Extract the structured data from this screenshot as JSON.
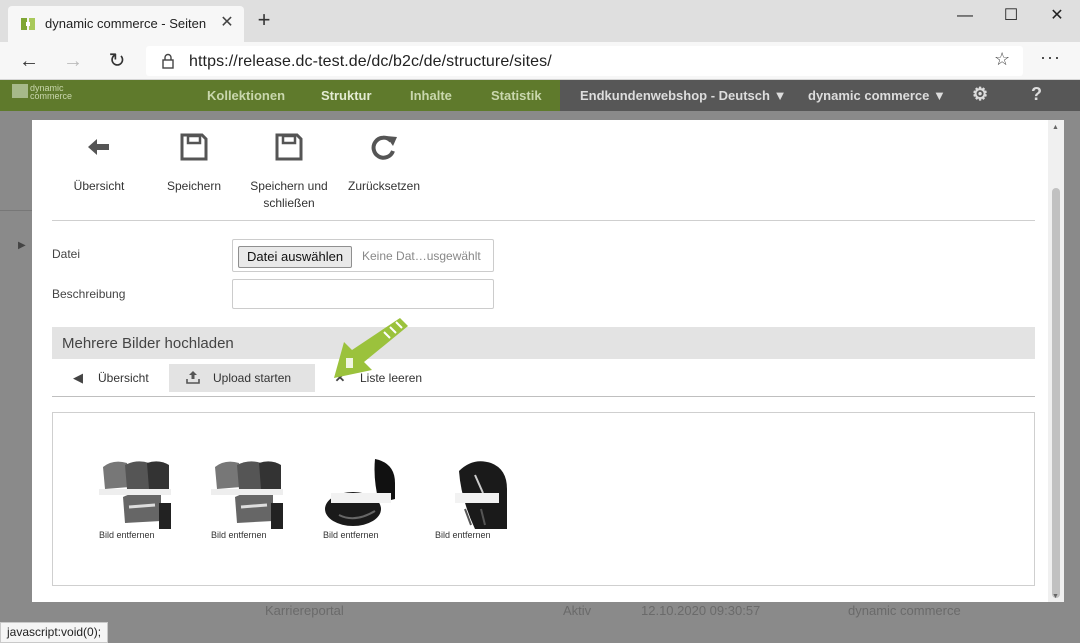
{
  "browser": {
    "tab_title": "dynamic commerce - Seiten",
    "url": "https://release.dc-test.de/dc/b2c/de/structure/sites/",
    "status_url": "javascript:void(0);"
  },
  "app": {
    "logo_line1": "dynamic",
    "logo_line2": "commerce",
    "nav": [
      "Kollektionen",
      "Struktur",
      "Inhalte",
      "Statistik"
    ],
    "shop_select": "Endkundenwebshop - Deutsch",
    "company_select": "dynamic commerce",
    "background_row": {
      "name": "Karriereportal",
      "status": "Aktiv",
      "date": "12.10.2020 09:30:57",
      "owner": "dynamic commerce"
    }
  },
  "toolbar": {
    "overview": "Übersicht",
    "save": "Speichern",
    "save_close_1": "Speichern und",
    "save_close_2": "schließen",
    "reset": "Zurücksetzen"
  },
  "form": {
    "file_label": "Datei",
    "file_button": "Datei auswählen",
    "file_status": "Keine Dat…usgewählt",
    "description_label": "Beschreibung",
    "description_value": ""
  },
  "upload": {
    "section_title": "Mehrere Bilder hochladen",
    "overview": "Übersicht",
    "start": "Upload starten",
    "clear": "Liste leeren",
    "images": [
      {
        "caption": "Bild entfernen",
        "kind": "irons"
      },
      {
        "caption": "Bild entfernen",
        "kind": "irons"
      },
      {
        "caption": "Bild entfernen",
        "kind": "driver"
      },
      {
        "caption": "Bild entfernen",
        "kind": "woods"
      }
    ]
  },
  "colors": {
    "nav_green": "#5f7a2c",
    "accent_green": "#9bc23c"
  }
}
